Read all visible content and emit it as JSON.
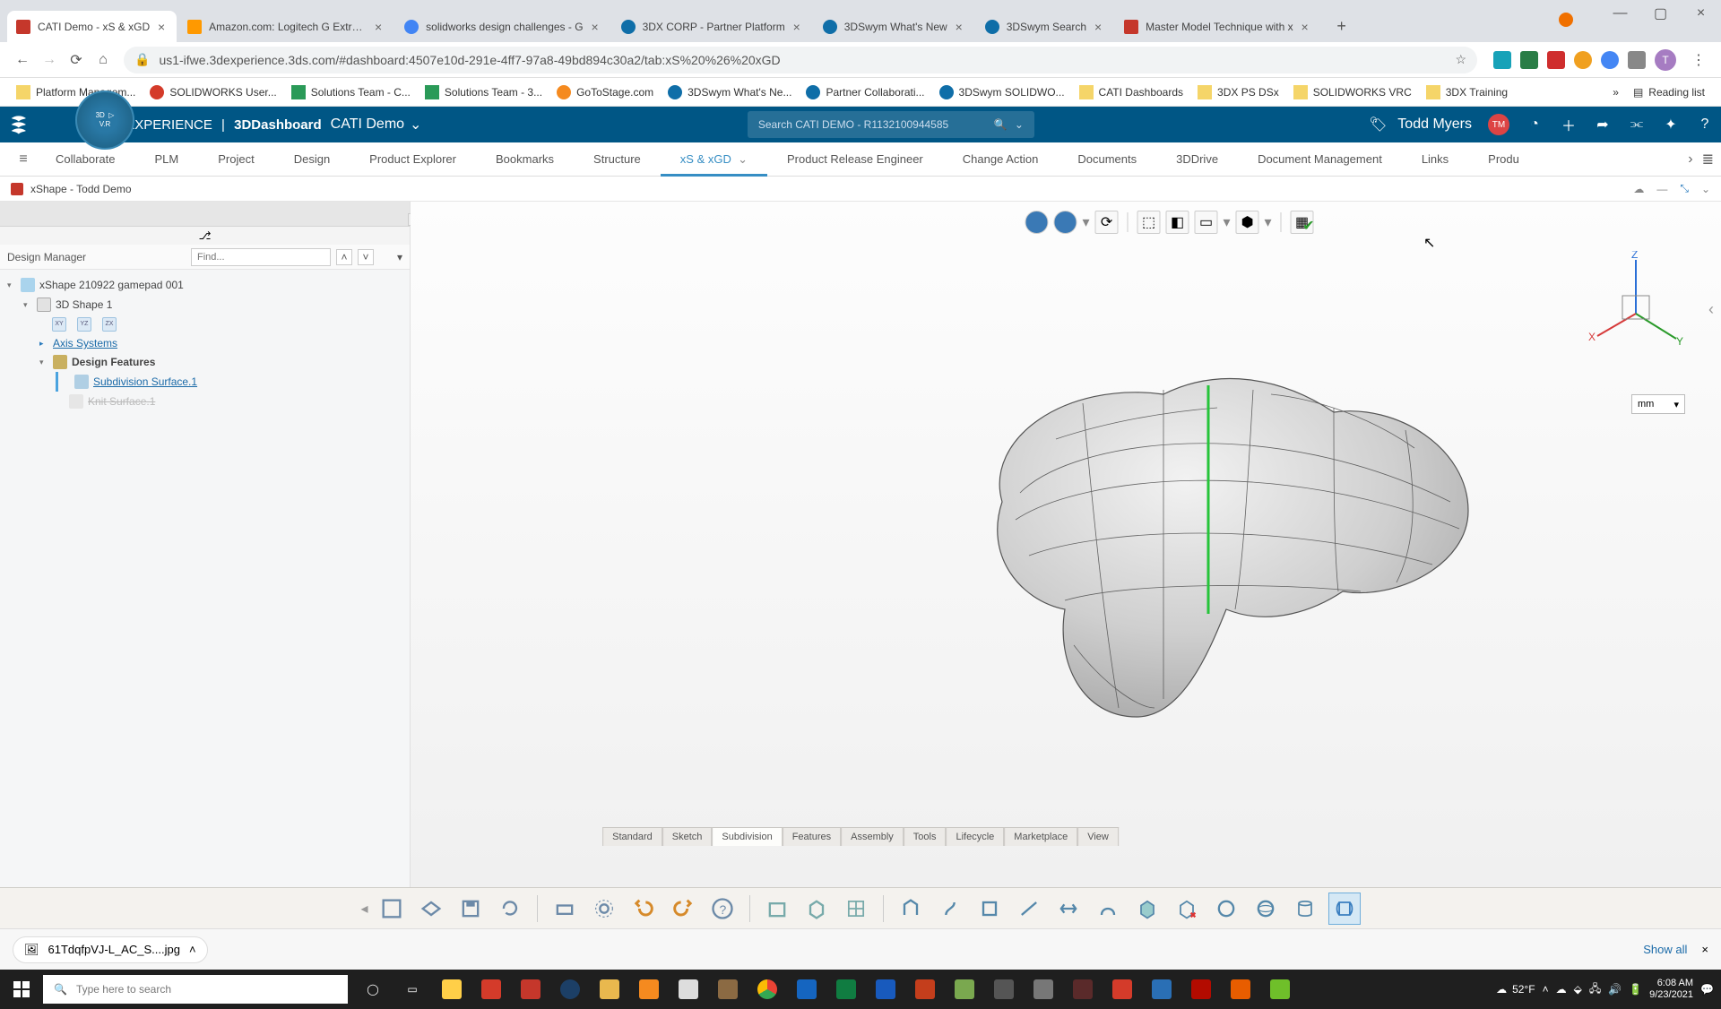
{
  "browser": {
    "tabs": [
      {
        "title": "CATI Demo - xS & xGD",
        "favicon": "#c5372b",
        "active": true
      },
      {
        "title": "Amazon.com: Logitech G Extrem",
        "favicon": "#ff9900"
      },
      {
        "title": "solidworks design challenges - G",
        "favicon": "#4285f4"
      },
      {
        "title": "3DX CORP - Partner Platform",
        "favicon": "#0f6ea8"
      },
      {
        "title": "3DSwym What's New",
        "favicon": "#0f6ea8"
      },
      {
        "title": "3DSwym Search",
        "favicon": "#0f6ea8"
      },
      {
        "title": "Master Model Technique with x",
        "favicon": "#c5372b"
      }
    ],
    "url": "us1-ifwe.3dexperience.3ds.com/#dashboard:4507e10d-291e-4ff7-97a8-49bd894c30a2/tab:xS%20%26%20xGD",
    "bookmarks": [
      {
        "label": "Platform Managem...",
        "color": "#f5d569"
      },
      {
        "label": "SOLIDWORKS User...",
        "color": "#d43b2a"
      },
      {
        "label": "Solutions Team - C...",
        "color": "#2a9a58"
      },
      {
        "label": "Solutions Team - 3...",
        "color": "#2a9a58"
      },
      {
        "label": "GoToStage.com",
        "color": "#f58a1f"
      },
      {
        "label": "3DSwym What's Ne...",
        "color": "#0f6ea8"
      },
      {
        "label": "Partner Collaborati...",
        "color": "#0f6ea8"
      },
      {
        "label": "3DSwym SOLIDWO...",
        "color": "#0f6ea8"
      },
      {
        "label": "CATI Dashboards",
        "color": "#f5d569"
      },
      {
        "label": "3DX PS DSx",
        "color": "#f5d569"
      },
      {
        "label": "SOLIDWORKS VRC",
        "color": "#f5d569"
      },
      {
        "label": "3DX Training",
        "color": "#f5d569"
      }
    ],
    "reading_list": "Reading list"
  },
  "header": {
    "brand_light": "3D",
    "brand_bold1": "EXPERIENCE",
    "sep": " | ",
    "brand_bold2": "3DDashboard",
    "context": "CATI Demo",
    "search_placeholder": "Search CATI DEMO - R1132100944585",
    "user_name": "Todd Myers",
    "user_initials": "TM"
  },
  "dashboard_tabs": [
    "Collaborate",
    "PLM",
    "Project",
    "Design",
    "Product Explorer",
    "Bookmarks",
    "Structure",
    "xS & xGD",
    "Product Release Engineer",
    "Change Action",
    "Documents",
    "3DDrive",
    "Document Management",
    "Links",
    "Produ"
  ],
  "dashboard_active": "xS & xGD",
  "widget": {
    "title": "xShape - Todd Demo"
  },
  "tree": {
    "panel_label": "Design Manager",
    "find_placeholder": "Find...",
    "root": "xShape 210922 gamepad 001",
    "shape": "3D Shape 1",
    "planes": [
      "XY",
      "YZ",
      "ZX"
    ],
    "axis": "Axis Systems",
    "features_label": "Design Features",
    "feat1": "Subdivision Surface.1",
    "feat2": "Knit Surface.1"
  },
  "viewport": {
    "unit": "mm",
    "axes": {
      "x": "X",
      "y": "Y",
      "z": "Z"
    }
  },
  "bottom_tabs": [
    "Standard",
    "Sketch",
    "Subdivision",
    "Features",
    "Assembly",
    "Tools",
    "Lifecycle",
    "Marketplace",
    "View"
  ],
  "bottom_active": "Subdivision",
  "download": {
    "file": "61TdqfpVJ-L_AC_S....jpg",
    "show_all": "Show all"
  },
  "taskbar": {
    "search_placeholder": "Type here to search",
    "weather_temp": "52°F",
    "time": "6:08 AM",
    "date": "9/23/2021"
  }
}
